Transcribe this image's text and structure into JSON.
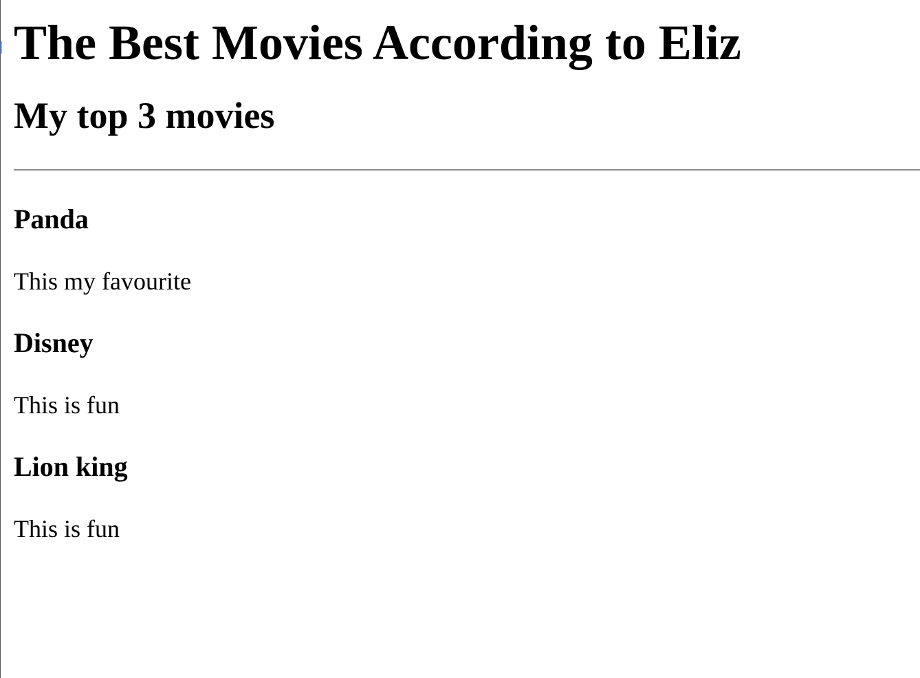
{
  "page": {
    "heading": "The Best Movies According to Eliz",
    "subheading": "My top 3 movies"
  },
  "movies": [
    {
      "title": "Panda",
      "description": "This my favourite"
    },
    {
      "title": "Disney",
      "description": "This is fun"
    },
    {
      "title": "Lion king",
      "description": "This is fun"
    }
  ]
}
